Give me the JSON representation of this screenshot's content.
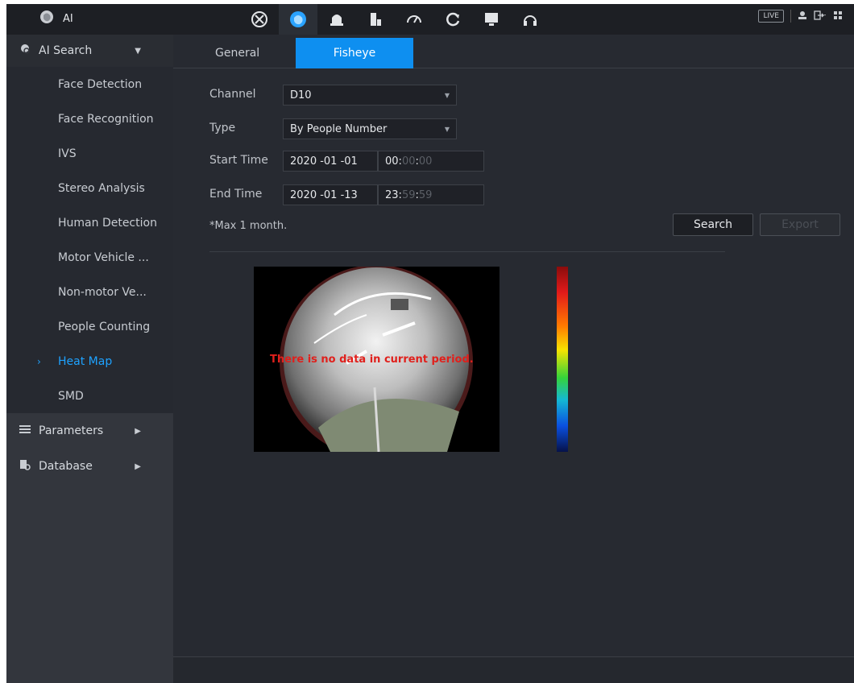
{
  "app": {
    "title": "AI",
    "live_label": "LIVE"
  },
  "topbar_icons": [
    "ptz-icon",
    "ai-icon",
    "camera-icon",
    "storage-icon",
    "performance-icon",
    "backup-icon",
    "display-icon",
    "audio-icon"
  ],
  "sidebar": {
    "ai_search": {
      "label": "AI Search"
    },
    "items": [
      {
        "label": "Face Detection"
      },
      {
        "label": "Face Recognition"
      },
      {
        "label": "IVS"
      },
      {
        "label": "Stereo Analysis"
      },
      {
        "label": "Human Detection"
      },
      {
        "label": "Motor Vehicle ..."
      },
      {
        "label": "Non-motor Ve..."
      },
      {
        "label": "People Counting"
      },
      {
        "label": "Heat Map"
      },
      {
        "label": "SMD"
      }
    ],
    "parameters": {
      "label": "Parameters"
    },
    "database": {
      "label": "Database"
    }
  },
  "tabs": {
    "general": "General",
    "fisheye": "Fisheye"
  },
  "form": {
    "channel_label": "Channel",
    "channel_value": "D10",
    "type_label": "Type",
    "type_value": "By People Number",
    "start_label": "Start Time",
    "start_date": "2020 -01 -01",
    "start_hour": "00",
    "start_min": "00",
    "start_sec": "00",
    "end_label": "End Time",
    "end_date": "2020 -01 -13",
    "end_hour": "23",
    "end_min": "59",
    "end_sec": "59",
    "note": "*Max 1 month."
  },
  "buttons": {
    "search": "Search",
    "export": "Export"
  },
  "heatmap": {
    "message": "There is no data in current period."
  },
  "colors": {
    "accent": "#0e8ff0",
    "active_text": "#1ea2ff",
    "message_red": "#e0201c"
  }
}
